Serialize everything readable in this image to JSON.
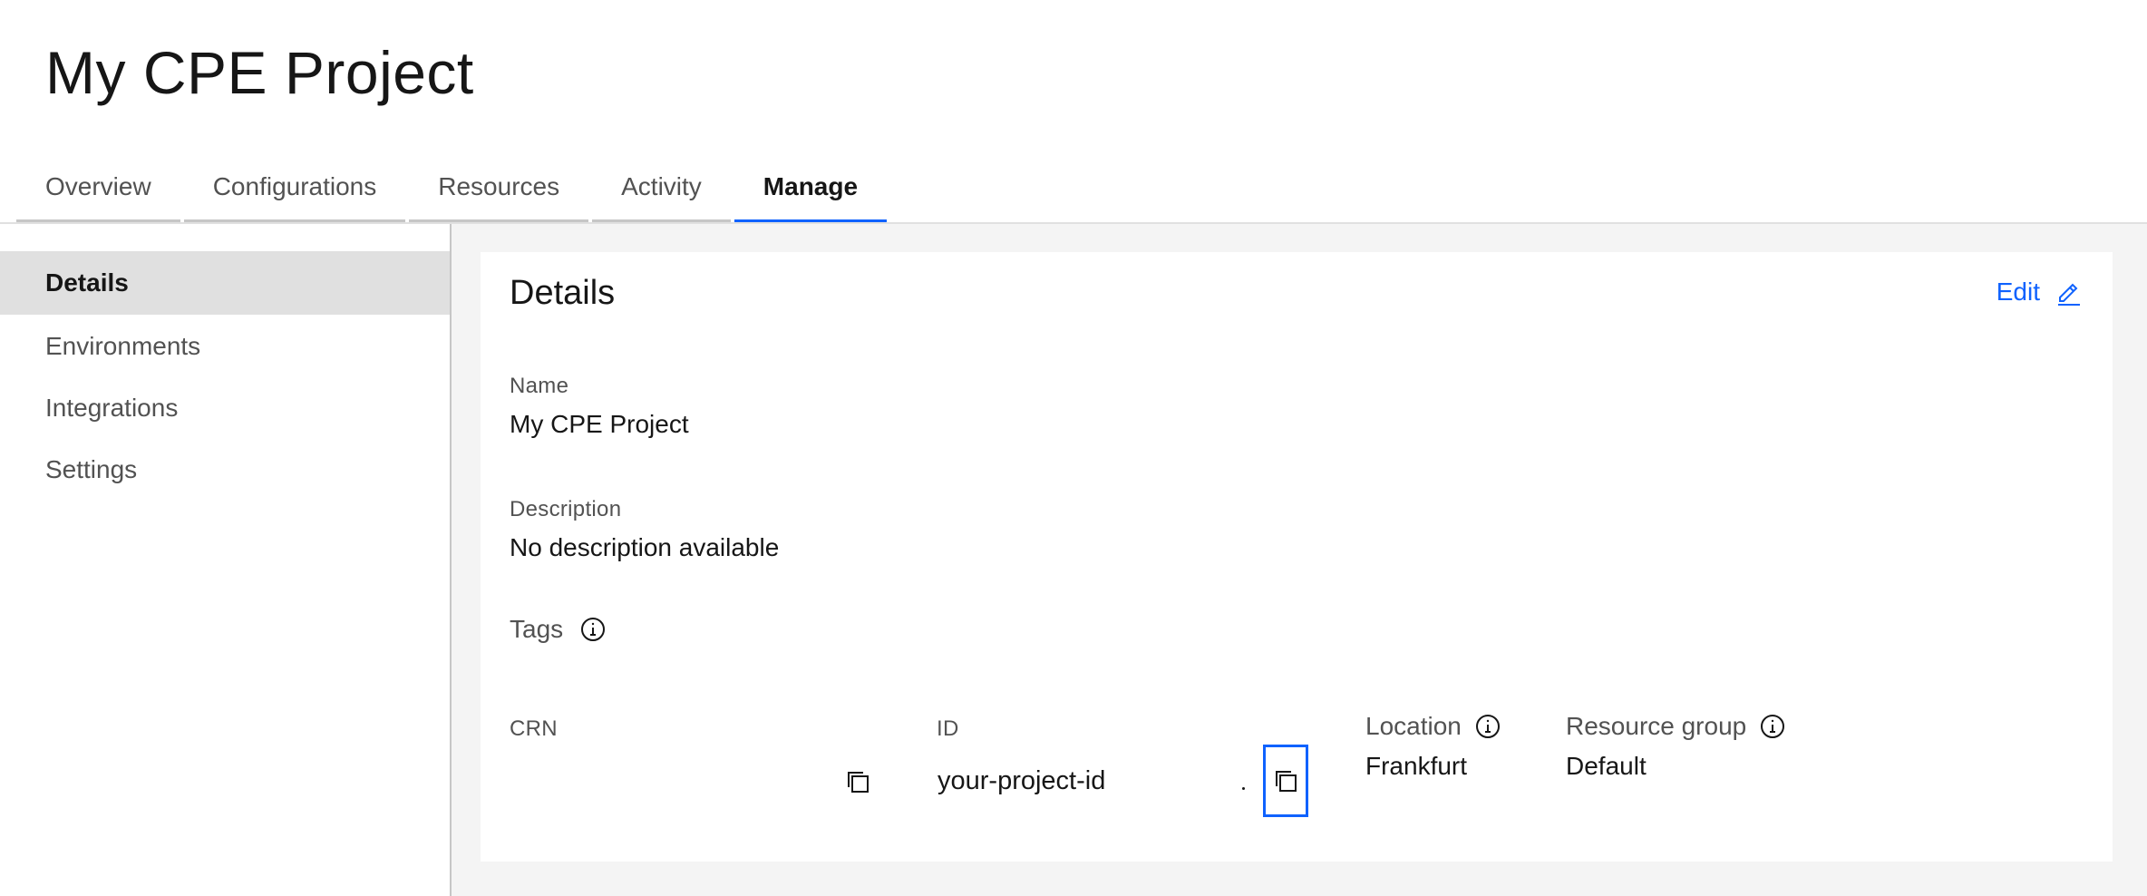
{
  "page": {
    "title": "My CPE Project"
  },
  "tabs": [
    {
      "label": "Overview",
      "active": false
    },
    {
      "label": "Configurations",
      "active": false
    },
    {
      "label": "Resources",
      "active": false
    },
    {
      "label": "Activity",
      "active": false
    },
    {
      "label": "Manage",
      "active": true
    }
  ],
  "sidebar": {
    "items": [
      {
        "label": "Details",
        "active": true
      },
      {
        "label": "Environments",
        "active": false
      },
      {
        "label": "Integrations",
        "active": false
      },
      {
        "label": "Settings",
        "active": false
      }
    ]
  },
  "details": {
    "title": "Details",
    "edit_label": "Edit",
    "name_label": "Name",
    "name_value": "My CPE Project",
    "description_label": "Description",
    "description_value": "No description available",
    "tags_label": "Tags",
    "crn_label": "CRN",
    "crn_value": "",
    "id_label": "ID",
    "id_value": "your-project-id",
    "location_label": "Location",
    "location_value": "Frankfurt",
    "resource_group_label": "Resource group",
    "resource_group_value": "Default"
  },
  "icons": {
    "edit": "pencil-icon",
    "info": "info-icon",
    "copy": "copy-icon"
  },
  "colors": {
    "accent": "#0f62fe",
    "active_sidebar_bg": "#e0e0e0",
    "content_bg": "#f4f4f4"
  }
}
